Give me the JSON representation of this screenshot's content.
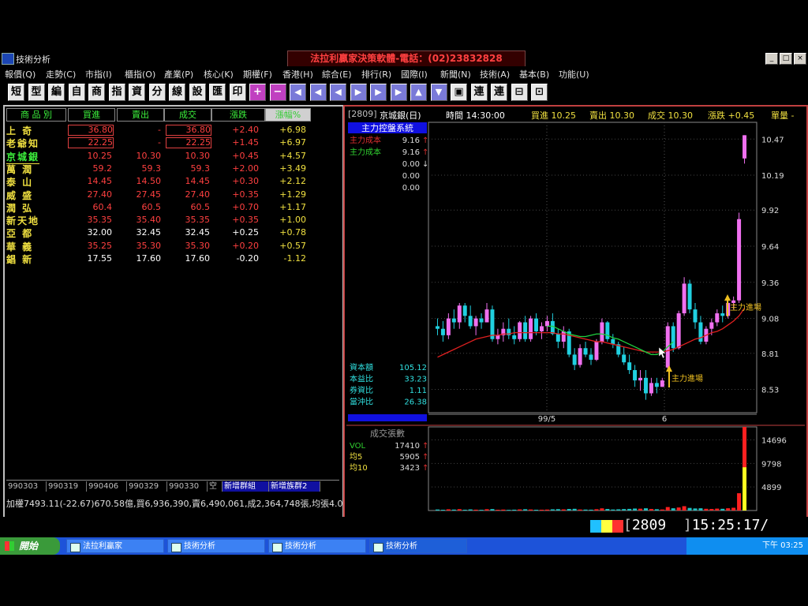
{
  "window": {
    "title": "技術分析",
    "banner": "法拉利贏家決策軟體-電話：(02)23832828",
    "min": "_",
    "max": "□",
    "close": "×"
  },
  "menu": [
    "報價(Q)",
    "走勢(C)",
    "市指(I)",
    "櫃指(O)",
    "產業(P)",
    "核心(K)",
    "期權(F)",
    "香港(H)",
    "綜合(E)",
    "排行(R)",
    "國際(I)",
    "新聞(N)",
    "技術(A)",
    "基本(B)",
    "功能(U)"
  ],
  "toolbar": [
    "短",
    "型",
    "編",
    "自",
    "商",
    "指",
    "資",
    "分",
    "線",
    "設",
    "匯",
    "印",
    "+",
    "−",
    "◀",
    "◀",
    "◀",
    "▶",
    "▶",
    "▶",
    "▲",
    "▼",
    "▣",
    "連",
    "連",
    "⊟",
    "⊡"
  ],
  "quotes": {
    "headers": [
      "商 品 別",
      "買進",
      "賣出",
      "成交",
      "漲跌",
      "漲幅%"
    ],
    "rows": [
      {
        "name": "上 奇",
        "bid": "36.80",
        "ask": "-",
        "last": "36.80",
        "chg": "+2.40",
        "pct": "+6.98",
        "boxed": true
      },
      {
        "name": "老爺知",
        "bid": "22.25",
        "ask": "-",
        "last": "22.25",
        "chg": "+1.45",
        "pct": "+6.97",
        "boxed": true
      },
      {
        "name": "京城銀",
        "bid": "10.25",
        "ask": "10.30",
        "last": "10.30",
        "chg": "+0.45",
        "pct": "+4.57"
      },
      {
        "name": "萬 潤",
        "bid": "59.2",
        "ask": "59.3",
        "last": "59.3",
        "chg": "+2.00",
        "pct": "+3.49"
      },
      {
        "name": "泰 山",
        "bid": "14.45",
        "ask": "14.50",
        "last": "14.45",
        "chg": "+0.30",
        "pct": "+2.12"
      },
      {
        "name": "威 盛",
        "bid": "27.40",
        "ask": "27.45",
        "last": "27.40",
        "chg": "+0.35",
        "pct": "+1.29"
      },
      {
        "name": "潤 弘",
        "bid": "60.4",
        "ask": "60.5",
        "last": "60.5",
        "chg": "+0.70",
        "pct": "+1.17"
      },
      {
        "name": "新天地",
        "bid": "35.35",
        "ask": "35.40",
        "last": "35.35",
        "chg": "+0.35",
        "pct": "+1.00"
      },
      {
        "name": "亞 都",
        "bid": "32.00",
        "ask": "32.45",
        "last": "32.45",
        "chg": "+0.25",
        "pct": "+0.78",
        "white": true
      },
      {
        "name": "華 義",
        "bid": "35.25",
        "ask": "35.30",
        "last": "35.30",
        "chg": "+0.20",
        "pct": "+0.57"
      },
      {
        "name": "錩 新",
        "bid": "17.55",
        "ask": "17.60",
        "last": "17.60",
        "chg": "-0.20",
        "pct": "-1.12",
        "white": true
      }
    ],
    "tabs": [
      "990303",
      "990319",
      "990406",
      "990329",
      "990330",
      "空",
      "新增群組",
      "新增族群2"
    ],
    "info": "加權7493.11(-22.67)670.58億,買6,936,390,賣6,490,061,成2,364,748張,均張4.0"
  },
  "chart": {
    "header": {
      "code": "[2809]",
      "name": "京城銀(日)",
      "time": "時間 14:30:00",
      "bid": "買進 10.25",
      "ask": "賣出 10.30",
      "last": "成交 10.30",
      "chg": "漲跌 +0.45",
      "unit": "單量 -"
    },
    "indicator": "主力控盤系統",
    "legend": [
      {
        "label": "主力成本",
        "value": "9.16",
        "color": "#e03030",
        "arrow": "↑"
      },
      {
        "label": "主力成本",
        "value": "9.16",
        "color": "#30d030",
        "arrow": "↑"
      },
      {
        "label": "",
        "value": "0.00",
        "color": "#ddd",
        "arrow": "↓"
      },
      {
        "label": "",
        "value": "0.00",
        "color": "#ddd",
        "arrow": ""
      },
      {
        "label": "",
        "value": "0.00",
        "color": "#ddd",
        "arrow": ""
      }
    ],
    "fundamentals": [
      {
        "label": "資本額",
        "value": "105.12"
      },
      {
        "label": "本益比",
        "value": "33.23"
      },
      {
        "label": "券資比",
        "value": "1.11"
      },
      {
        "label": "當沖比",
        "value": "26.38"
      }
    ],
    "yticks": [
      "10.47",
      "10.19",
      "9.92",
      "9.64",
      "9.36",
      "9.08",
      "8.81",
      "8.53"
    ],
    "xlabels": [
      "99/5",
      "6"
    ],
    "annotations": [
      "主力進場",
      "主力進場"
    ],
    "volume": {
      "title": "成交張數",
      "legend": [
        {
          "label": "VOL",
          "value": "17410",
          "arrow": "↑"
        },
        {
          "label": "均5",
          "value": "5905",
          "arrow": "↑"
        },
        {
          "label": "均10",
          "value": "3423",
          "arrow": "↑"
        }
      ],
      "yticks": [
        "14696",
        "9798",
        "4899"
      ]
    }
  },
  "chart_data": {
    "type": "candlestick",
    "title": "京城銀(日)",
    "ylim": [
      8.35,
      10.6
    ],
    "candles": [
      [
        9.02,
        9.08,
        8.95,
        9.0
      ],
      [
        9.0,
        9.06,
        8.9,
        8.95
      ],
      [
        8.95,
        9.12,
        8.92,
        9.08
      ],
      [
        9.08,
        9.15,
        9.0,
        9.05
      ],
      [
        9.05,
        9.2,
        9.0,
        9.18
      ],
      [
        9.18,
        9.2,
        9.05,
        9.1
      ],
      [
        9.1,
        9.18,
        9.0,
        9.02
      ],
      [
        9.02,
        9.1,
        8.95,
        9.08
      ],
      [
        9.08,
        9.12,
        9.0,
        9.05
      ],
      [
        9.05,
        9.2,
        9.05,
        9.15
      ],
      [
        9.15,
        9.18,
        8.9,
        8.92
      ],
      [
        8.92,
        9.0,
        8.88,
        8.95
      ],
      [
        8.95,
        9.05,
        8.9,
        9.0
      ],
      [
        9.0,
        9.08,
        8.92,
        8.95
      ],
      [
        8.95,
        9.02,
        8.88,
        8.92
      ],
      [
        8.92,
        9.06,
        8.9,
        9.05
      ],
      [
        9.05,
        9.1,
        8.9,
        8.92
      ],
      [
        8.92,
        9.1,
        8.9,
        9.08
      ],
      [
        9.08,
        9.12,
        8.95,
        8.98
      ],
      [
        8.98,
        9.05,
        8.92,
        9.02
      ],
      [
        9.02,
        9.1,
        8.98,
        9.06
      ],
      [
        9.06,
        9.12,
        8.95,
        8.96
      ],
      [
        8.96,
        9.0,
        8.85,
        8.9
      ],
      [
        8.9,
        9.02,
        8.85,
        8.98
      ],
      [
        8.98,
        9.0,
        8.78,
        8.8
      ],
      [
        8.8,
        8.85,
        8.68,
        8.72
      ],
      [
        8.72,
        8.88,
        8.7,
        8.85
      ],
      [
        8.85,
        8.9,
        8.78,
        8.8
      ],
      [
        8.8,
        8.85,
        8.72,
        8.76
      ],
      [
        8.76,
        8.92,
        8.75,
        8.9
      ],
      [
        8.9,
        9.08,
        8.88,
        9.05
      ],
      [
        9.05,
        9.06,
        8.9,
        8.92
      ],
      [
        8.92,
        8.96,
        8.85,
        8.88
      ],
      [
        8.88,
        8.9,
        8.78,
        8.8
      ],
      [
        8.8,
        8.86,
        8.72,
        8.74
      ],
      [
        8.74,
        8.8,
        8.65,
        8.68
      ],
      [
        8.68,
        8.72,
        8.55,
        8.6
      ],
      [
        8.6,
        8.68,
        8.52,
        8.62
      ],
      [
        8.62,
        8.68,
        8.45,
        8.5
      ],
      [
        8.5,
        8.62,
        8.48,
        8.58
      ],
      [
        8.58,
        8.62,
        8.5,
        8.55
      ],
      [
        8.55,
        8.62,
        8.55,
        8.6
      ],
      [
        8.7,
        9.05,
        8.68,
        9.02
      ],
      [
        9.02,
        9.05,
        8.82,
        8.85
      ],
      [
        8.85,
        9.14,
        8.84,
        9.12
      ],
      [
        9.12,
        9.4,
        9.1,
        9.35
      ],
      [
        9.35,
        9.38,
        9.12,
        9.15
      ],
      [
        9.15,
        9.2,
        9.0,
        9.05
      ],
      [
        9.05,
        9.1,
        8.88,
        8.9
      ],
      [
        8.9,
        9.02,
        8.88,
        9.0
      ],
      [
        9.0,
        9.08,
        8.95,
        9.05
      ],
      [
        9.05,
        9.15,
        9.02,
        9.12
      ],
      [
        9.12,
        9.18,
        9.05,
        9.1
      ],
      [
        9.1,
        9.22,
        9.08,
        9.2
      ],
      [
        9.2,
        9.25,
        9.15,
        9.22
      ],
      [
        9.22,
        9.9,
        9.2,
        9.85
      ],
      [
        10.32,
        10.5,
        10.28,
        10.5
      ]
    ],
    "volumes": [
      120,
      90,
      140,
      110,
      160,
      95,
      130,
      100,
      85,
      150,
      170,
      90,
      110,
      80,
      100,
      130,
      150,
      120,
      90,
      95,
      110,
      140,
      160,
      130,
      180,
      200,
      120,
      110,
      100,
      150,
      250,
      180,
      120,
      140,
      170,
      190,
      230,
      210,
      260,
      180,
      150,
      120,
      400,
      260,
      350,
      500,
      300,
      240,
      260,
      200,
      180,
      220,
      200,
      260,
      320,
      2000,
      7000
    ],
    "line_red": [
      8.78,
      8.8,
      8.82,
      8.84,
      8.86,
      8.88,
      8.9,
      8.92,
      8.93,
      8.94,
      8.95,
      8.95,
      8.96,
      8.96,
      8.97,
      8.97,
      8.97,
      8.97,
      8.97,
      8.97,
      8.97,
      8.97,
      8.96,
      8.96,
      8.95,
      8.94,
      8.93,
      8.92,
      8.91,
      8.9,
      8.9,
      8.89,
      8.88,
      8.87,
      8.86,
      8.85,
      8.84,
      8.83,
      8.82,
      8.82,
      8.82,
      8.82,
      8.83,
      8.84,
      8.86,
      8.88,
      8.9,
      8.92,
      8.93,
      8.95,
      8.97,
      8.98,
      9.0,
      9.03,
      9.06,
      9.1,
      9.16
    ],
    "line_green": {
      "start": 20,
      "values": [
        9.02,
        9.02,
        9.0,
        8.98,
        8.96,
        8.95,
        8.94,
        8.94,
        8.95,
        8.96,
        8.96,
        8.95,
        8.93,
        8.92,
        8.9,
        8.88,
        8.86,
        8.84,
        8.82,
        8.8,
        8.8,
        8.82,
        8.86,
        8.9
      ]
    },
    "vol_ylim": [
      0,
      17410
    ]
  }
}
